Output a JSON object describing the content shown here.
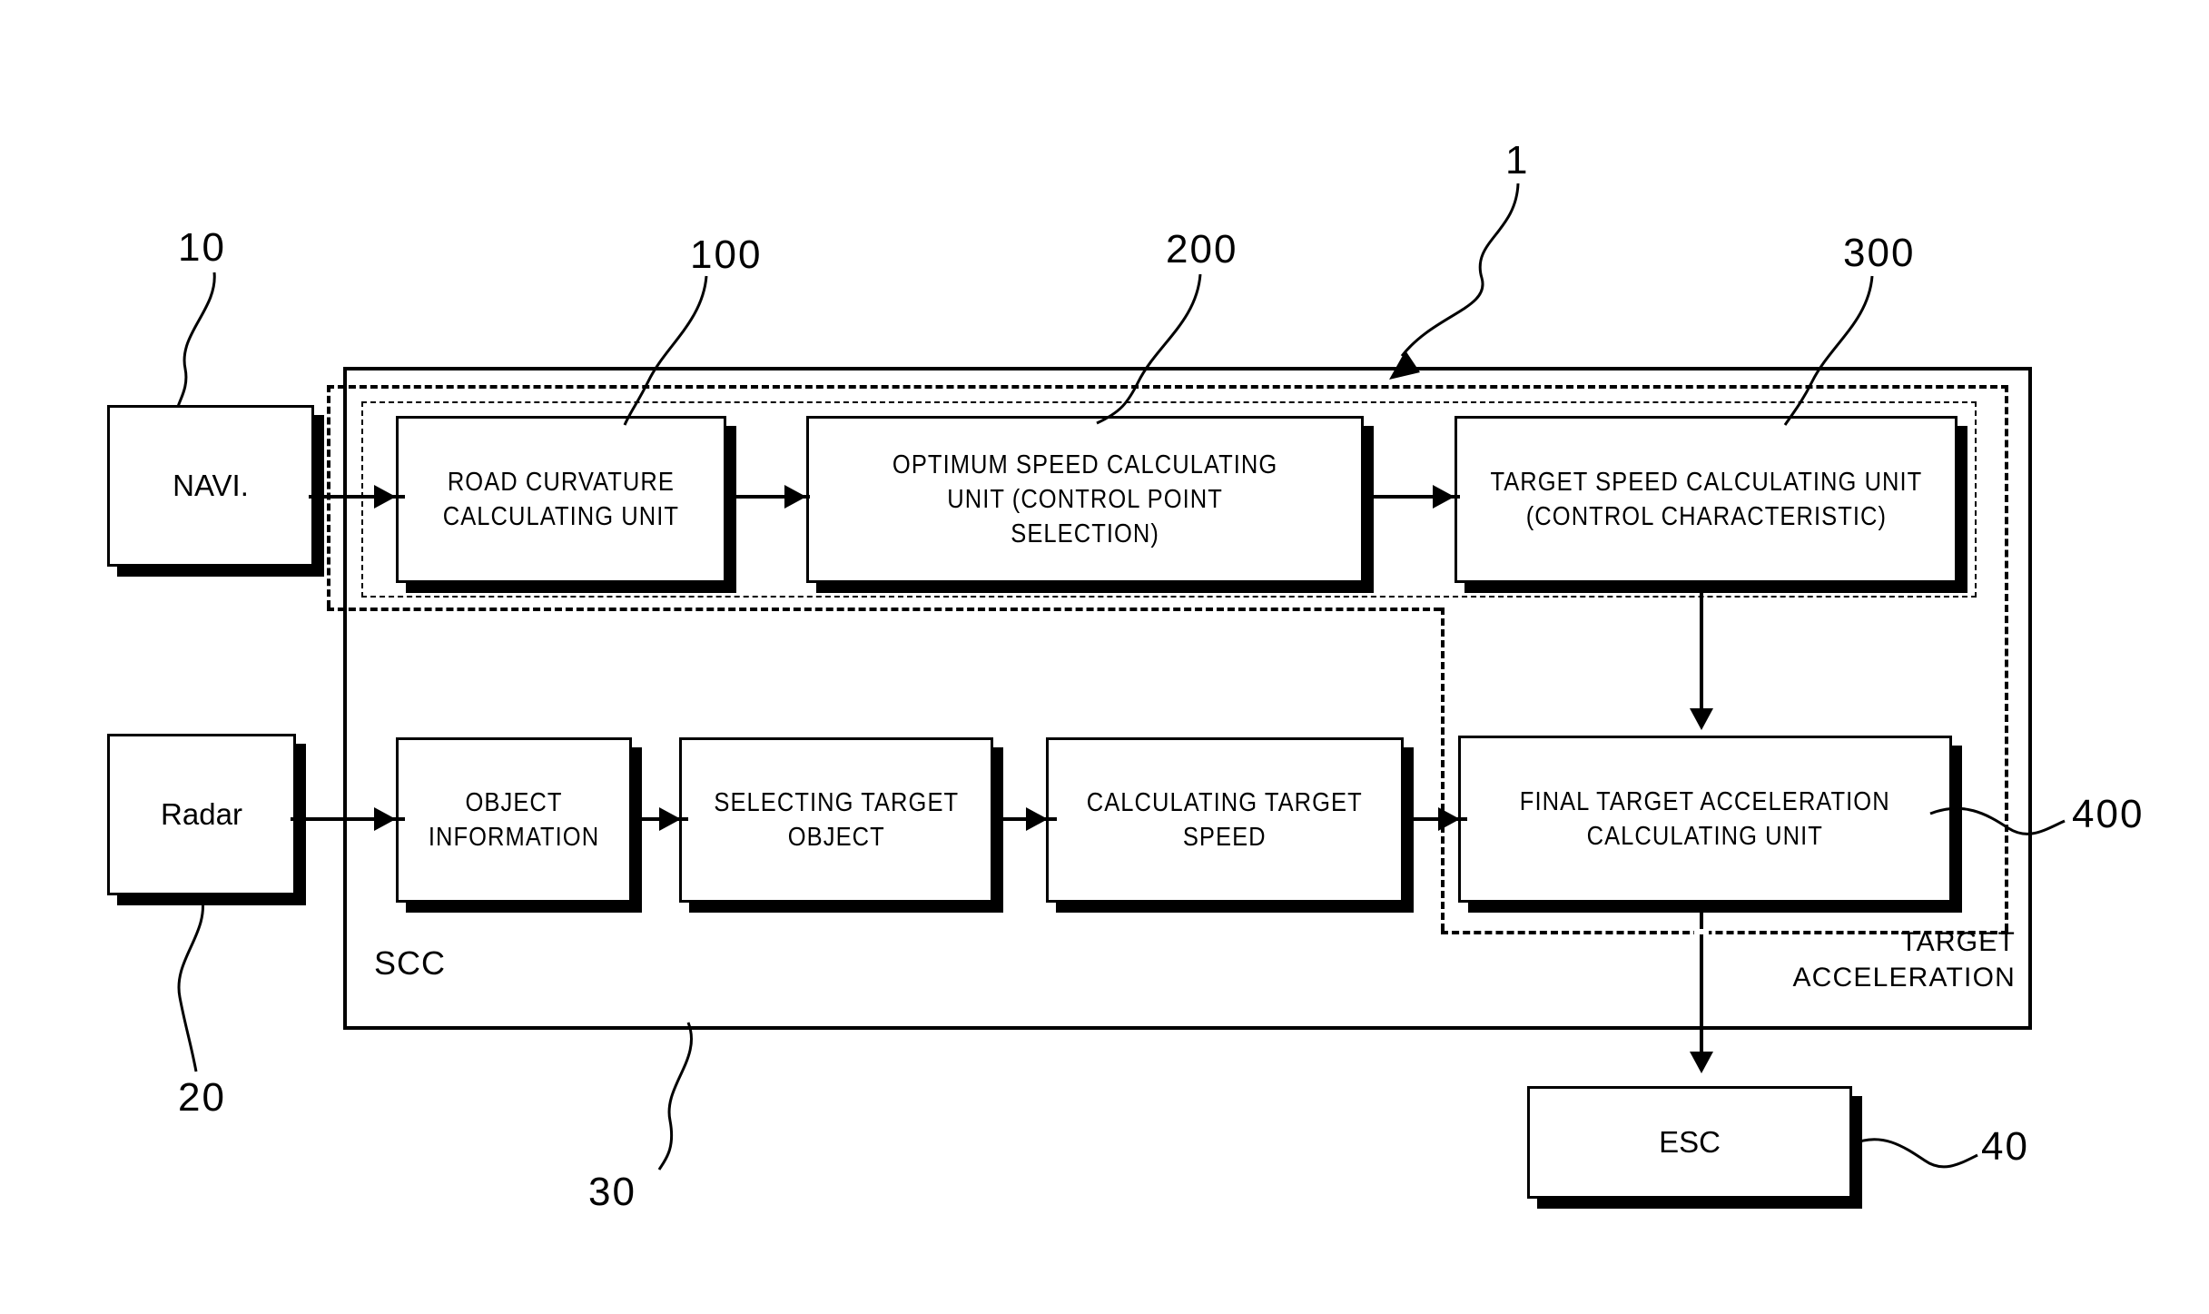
{
  "figure": {
    "title": "Vehicle speed control block diagram",
    "system_ref": "1"
  },
  "inputs": [
    {
      "id": "navi",
      "label": "NAVI.",
      "ref": "10"
    },
    {
      "id": "radar",
      "label": "Radar",
      "ref": "20"
    }
  ],
  "container": {
    "scc_label": "SCC",
    "scc_ref": "30",
    "target_accel_label": "TARGET\nACCELERATION",
    "dashed_group_ref": "400"
  },
  "top_row": [
    {
      "id": "road-curvature",
      "label": "ROAD CURVATURE\nCALCULATING UNIT",
      "ref": "100"
    },
    {
      "id": "optimum-speed",
      "label": "OPTIMUM SPEED CALCULATING\nUNIT (CONTROL POINT\nSELECTION)",
      "ref": "200"
    },
    {
      "id": "target-speed",
      "label": "TARGET SPEED CALCULATING UNIT\n(CONTROL CHARACTERISTIC)",
      "ref": "300"
    }
  ],
  "bottom_row": [
    {
      "id": "object-information",
      "label": "OBJECT\nINFORMATION"
    },
    {
      "id": "selecting-target-object",
      "label": "SELECTING TARGET\nOBJECT"
    },
    {
      "id": "calculating-target-speed",
      "label": "CALCULATING TARGET\nSPEED"
    },
    {
      "id": "final-target-acceleration",
      "label": "FINAL TARGET ACCELERATION\nCALCULATING UNIT"
    }
  ],
  "output": {
    "id": "esc",
    "label": "ESC",
    "ref": "40"
  },
  "colors": {
    "stroke": "#000000",
    "fill": "#ffffff"
  }
}
